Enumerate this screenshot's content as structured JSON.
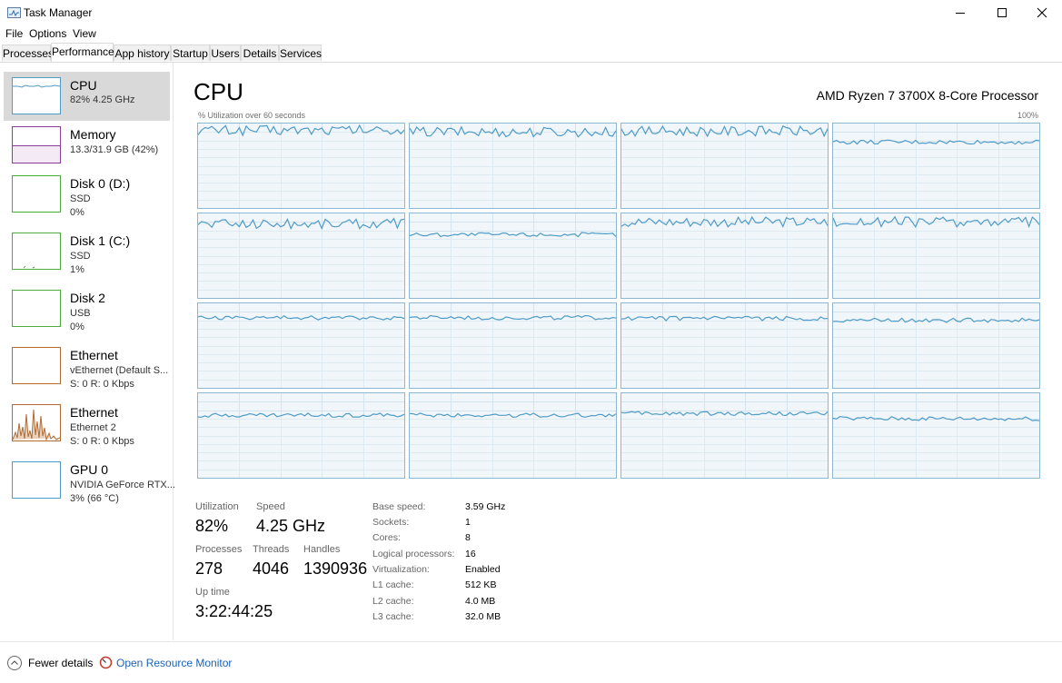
{
  "window": {
    "title": "Task Manager",
    "icon": "task-manager-icon",
    "controls": [
      "minimize-icon",
      "maximize-icon",
      "close-icon"
    ]
  },
  "menu": [
    "File",
    "Options",
    "View"
  ],
  "tabs": [
    "Processes",
    "Performance",
    "App history",
    "Startup",
    "Users",
    "Details",
    "Services"
  ],
  "active_tab": "Performance",
  "sidebar": {
    "items": [
      {
        "title": "CPU",
        "line1": "82% 4.25 GHz",
        "line2": "",
        "color": "#4f9bc7"
      },
      {
        "title": "Memory",
        "line1": "13.3/31.9 GB (42%)",
        "line2": "",
        "color": "#8b3d9c"
      },
      {
        "title": "Disk 0 (D:)",
        "line1": "SSD",
        "line2": "0%",
        "color": "#4dab3c"
      },
      {
        "title": "Disk 1 (C:)",
        "line1": "SSD",
        "line2": "1%",
        "color": "#4dab3c"
      },
      {
        "title": "Disk 2",
        "line1": "USB",
        "line2": "0%",
        "color": "#4dab3c"
      },
      {
        "title": "Ethernet",
        "line1": "vEthernet (Default S...",
        "line2": "S: 0 R: 0 Kbps",
        "color": "#b06b33"
      },
      {
        "title": "Ethernet",
        "line1": "Ethernet 2",
        "line2": "S: 0 R: 0 Kbps",
        "color": "#b06b33"
      },
      {
        "title": "GPU 0",
        "line1": "NVIDIA GeForce RTX...",
        "line2": "3% (66 °C)",
        "color": "#4f9bc7"
      }
    ]
  },
  "main": {
    "heading": "CPU",
    "cpu_model": "AMD Ryzen 7 3700X 8-Core Processor",
    "graph_caption": "% Utilization over 60 seconds",
    "graph_max": "100%",
    "core_levels": [
      0.92,
      0.9,
      0.91,
      0.78,
      0.88,
      0.75,
      0.9,
      0.9,
      0.83,
      0.83,
      0.82,
      0.8,
      0.74,
      0.74,
      0.76,
      0.7
    ],
    "stats": {
      "utilization": {
        "label": "Utilization",
        "value": "82%"
      },
      "speed": {
        "label": "Speed",
        "value": "4.25 GHz"
      },
      "processes": {
        "label": "Processes",
        "value": "278"
      },
      "threads": {
        "label": "Threads",
        "value": "4046"
      },
      "handles": {
        "label": "Handles",
        "value": "1390936"
      },
      "uptime": {
        "label": "Up time",
        "value": "3:22:44:25"
      }
    },
    "info": [
      {
        "label": "Base speed:",
        "value": "3.59 GHz"
      },
      {
        "label": "Sockets:",
        "value": "1"
      },
      {
        "label": "Cores:",
        "value": "8"
      },
      {
        "label": "Logical processors:",
        "value": "16"
      },
      {
        "label": "Virtualization:",
        "value": "Enabled"
      },
      {
        "label": "L1 cache:",
        "value": "512 KB"
      },
      {
        "label": "L2 cache:",
        "value": "4.0 MB"
      },
      {
        "label": "L3 cache:",
        "value": "32.0 MB"
      }
    ]
  },
  "footer": {
    "fewer_details": "Fewer details",
    "open_resource_monitor": "Open Resource Monitor"
  },
  "colors": {
    "cpu_line": "#4f9bc7",
    "cpu_border": "#8bb7d2",
    "cpu_fill": "#f1f6fa",
    "link": "#1b63b6"
  }
}
